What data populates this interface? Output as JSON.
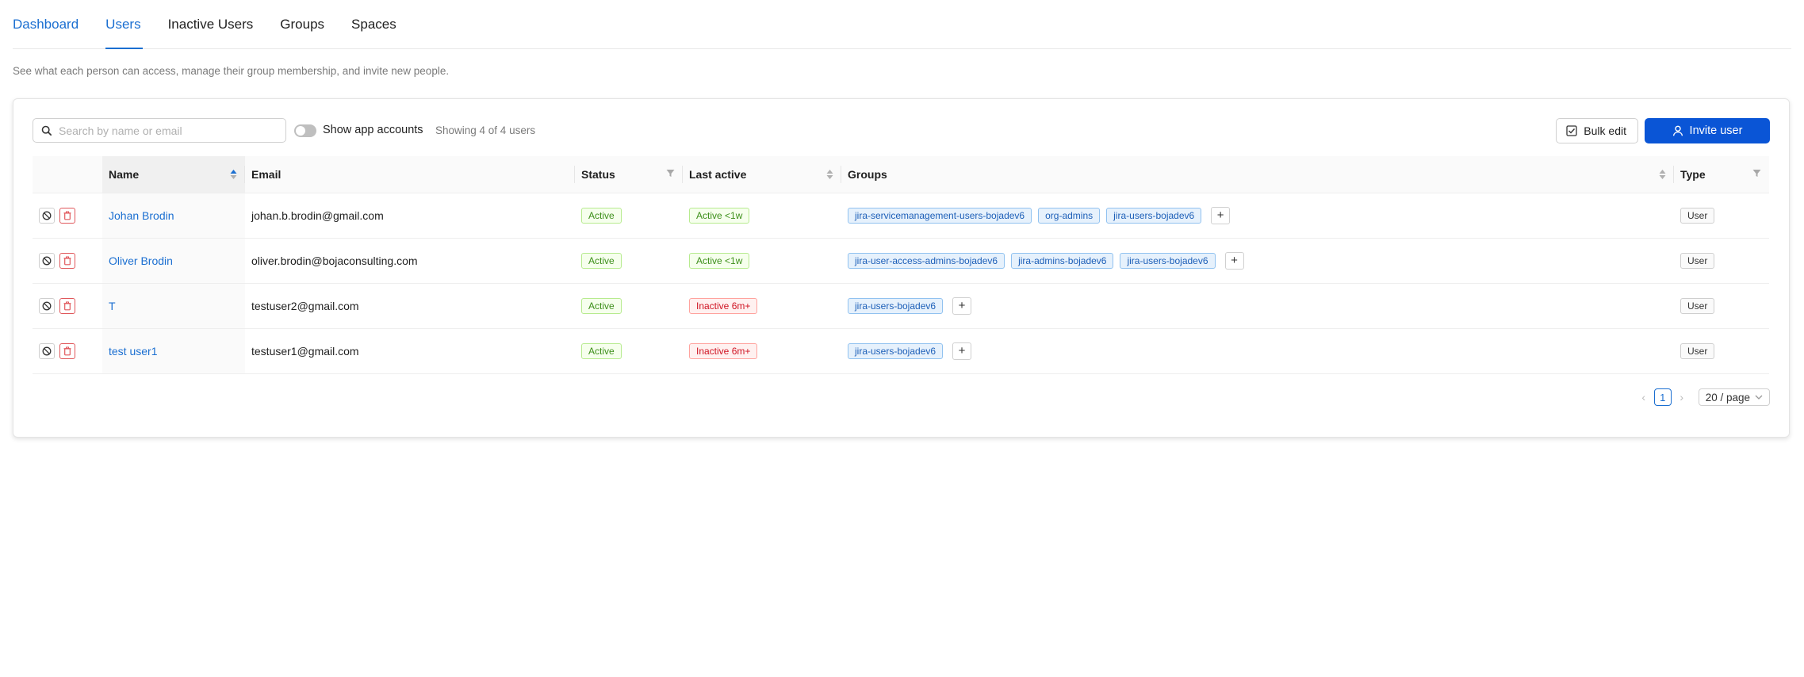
{
  "tabs": [
    {
      "label": "Dashboard"
    },
    {
      "label": "Users"
    },
    {
      "label": "Inactive Users"
    },
    {
      "label": "Groups"
    },
    {
      "label": "Spaces"
    }
  ],
  "subtitle": "See what each person can access, manage their group membership, and invite new people.",
  "toolbar": {
    "search_placeholder": "Search by name or email",
    "search_value": "",
    "show_app_accounts_label": "Show app accounts",
    "show_app_accounts_on": false,
    "count_text": "Showing 4 of 4 users",
    "bulk_edit_label": "Bulk edit",
    "invite_label": "Invite user"
  },
  "table": {
    "columns": {
      "name": "Name",
      "email": "Email",
      "status": "Status",
      "last_active": "Last active",
      "groups": "Groups",
      "type": "Type"
    },
    "rows": [
      {
        "name": "Johan Brodin",
        "email": "johan.b.brodin@gmail.com",
        "status": "Active",
        "last_active": "Active <1w",
        "last_active_state": "recent",
        "groups": [
          "jira-servicemanagement-users-bojadev6",
          "org-admins",
          "jira-users-bojadev6"
        ],
        "type": "User"
      },
      {
        "name": "Oliver Brodin",
        "email": "oliver.brodin@bojaconsulting.com",
        "status": "Active",
        "last_active": "Active <1w",
        "last_active_state": "recent",
        "groups": [
          "jira-user-access-admins-bojadev6",
          "jira-admins-bojadev6",
          "jira-users-bojadev6"
        ],
        "type": "User"
      },
      {
        "name": "T",
        "email": "testuser2@gmail.com",
        "status": "Active",
        "last_active": "Inactive 6m+",
        "last_active_state": "inactive",
        "groups": [
          "jira-users-bojadev6"
        ],
        "type": "User"
      },
      {
        "name": "test user1",
        "email": "testuser1@gmail.com",
        "status": "Active",
        "last_active": "Inactive 6m+",
        "last_active_state": "inactive",
        "groups": [
          "jira-users-bojadev6"
        ],
        "type": "User"
      }
    ],
    "add_group_label": "+"
  },
  "pagination": {
    "current_page": "1",
    "page_size": "20 / page"
  },
  "colors": {
    "accent": "#1b6fd1",
    "primary_button": "#0a55d6",
    "status_green": "#3d8f1a",
    "status_red": "#cf1322"
  }
}
